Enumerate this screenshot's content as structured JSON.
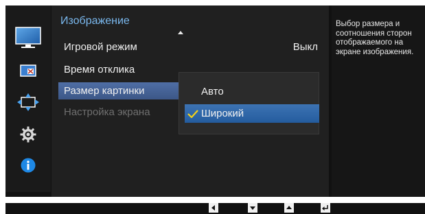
{
  "menu": {
    "title": "Изображение",
    "items": [
      {
        "label": "Игровой режим",
        "value": "Выкл"
      },
      {
        "label": "Время отклика",
        "value": ""
      },
      {
        "label": "Размер картинки",
        "value": ""
      },
      {
        "label": "Настройка экрана",
        "value": ""
      }
    ]
  },
  "submenu": {
    "options": [
      {
        "label": "Авто"
      },
      {
        "label": "Широкий"
      }
    ]
  },
  "help_text": "Выбор размера и соотношения сторон отображаемого на экране изображения.",
  "sidebar": {
    "icons": [
      "picture-icon",
      "color-icon",
      "resize-icon",
      "settings-gear-icon",
      "info-icon"
    ]
  },
  "colors": {
    "accent": "#7ab8ee",
    "selected_item": "#4f6ea5",
    "selected_option": "#2f68aa",
    "check": "#f5d21a"
  },
  "nav_buttons": [
    "left-arrow-icon",
    "down-arrow-icon",
    "up-arrow-icon",
    "enter-icon"
  ]
}
